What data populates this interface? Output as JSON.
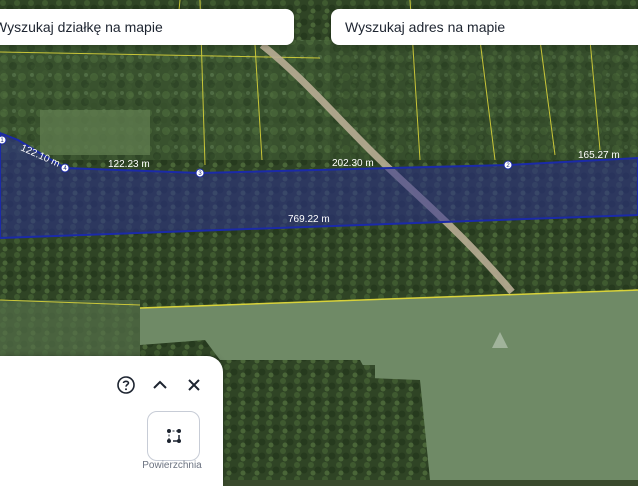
{
  "search": {
    "parcel_label": "Wyszukaj działkę na mapie",
    "address_label": "Wyszukaj adres na mapie"
  },
  "map": {
    "segment_labels": [
      "122.10 m",
      "122.23 m",
      "202.30 m",
      "165.27 m",
      "769.22 m"
    ],
    "vertex_labels": [
      "1",
      "4",
      "3",
      "2"
    ],
    "colors": {
      "parcel_boundary": "#1b2aa8",
      "parcel_fill": "#2b2f8f",
      "plot_lines": "#d8d23a",
      "road": "#b9ad95",
      "field": "#6f8a66"
    }
  },
  "panel": {
    "help_icon": "question-circle-icon",
    "collapse_icon": "chevron-up-icon",
    "close_icon": "close-icon",
    "tool_icon": "area-measure-icon",
    "tool_label": "Powierzchnia"
  }
}
